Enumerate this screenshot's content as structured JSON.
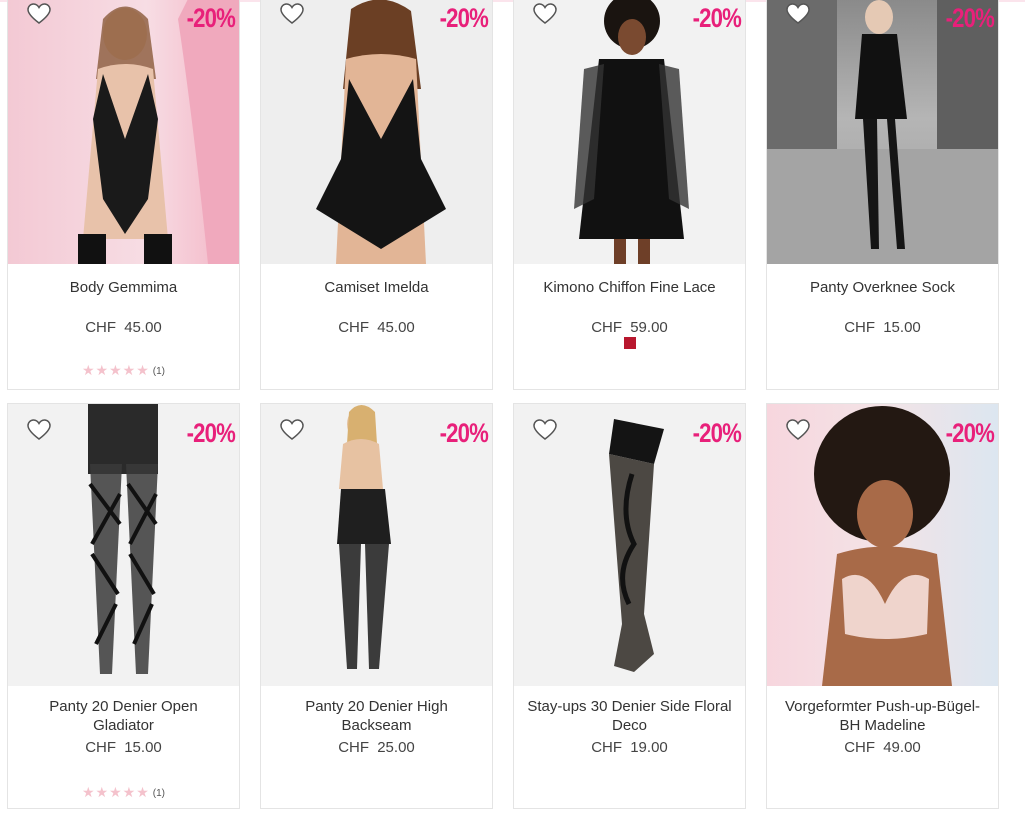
{
  "products": [
    {
      "name": "Body Gemmima",
      "price": "CHF 45.00",
      "badge": "-20%",
      "rating": "★★★★★",
      "review_count": "(1)"
    },
    {
      "name": "Camiset Imelda",
      "price": "CHF 45.00",
      "badge": "-20%"
    },
    {
      "name": "Kimono Chiffon Fine Lace",
      "price": "CHF 59.00",
      "badge": "-20%",
      "swatch_color": "#b8172e"
    },
    {
      "name": "Panty Overknee Sock",
      "price": "CHF 15.00",
      "badge": "-20%"
    },
    {
      "name": "Panty 20 Denier Open Gladiator",
      "price": "CHF 15.00",
      "badge": "-20%",
      "rating": "★★★★★",
      "review_count": "(1)"
    },
    {
      "name": "Panty 20 Denier High Backseam",
      "price": "CHF 25.00",
      "badge": "-20%"
    },
    {
      "name": "Stay-ups 30 Denier Side Floral Deco",
      "price": "CHF 19.00",
      "badge": "-20%"
    },
    {
      "name": "Vorgeformter Push-up-Bügel-BH Madeline",
      "price": "CHF 49.00",
      "badge": "-20%"
    }
  ],
  "colors": {
    "badge": "#e8207a",
    "star": "#f4c2cc",
    "swatch": "#b8172e"
  }
}
